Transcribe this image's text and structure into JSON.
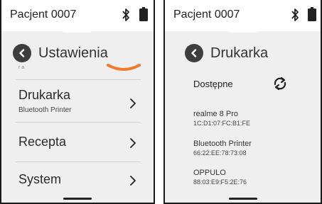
{
  "screen_left": {
    "status": {
      "title": "Pacjent 0007"
    },
    "header": {
      "title": "Ustawienia"
    },
    "partial_label": "r a",
    "menu": [
      {
        "label": "Drukarka",
        "sublabel": "Bluetooth Printer"
      },
      {
        "label": "Recepta"
      },
      {
        "label": "System"
      }
    ]
  },
  "screen_right": {
    "status": {
      "title": "Pacjent 0007"
    },
    "header": {
      "title": "Drukarka"
    },
    "section_title": "Dostępne",
    "devices": [
      {
        "name": "realme 8 Pro",
        "address": "1C:D1:07:FC:B1:FE"
      },
      {
        "name": "Bluetooth Printer",
        "address": "66:22:EE:78:73:08"
      },
      {
        "name": "OPPULO",
        "address": "88:03:E9:F5:2E:76"
      }
    ]
  },
  "colors": {
    "accent": "#f07a2a",
    "back_button": "#3e3e3e"
  },
  "icons": [
    "bluetooth-icon",
    "battery-icon",
    "back-icon",
    "chevron-right-icon",
    "refresh-icon"
  ]
}
